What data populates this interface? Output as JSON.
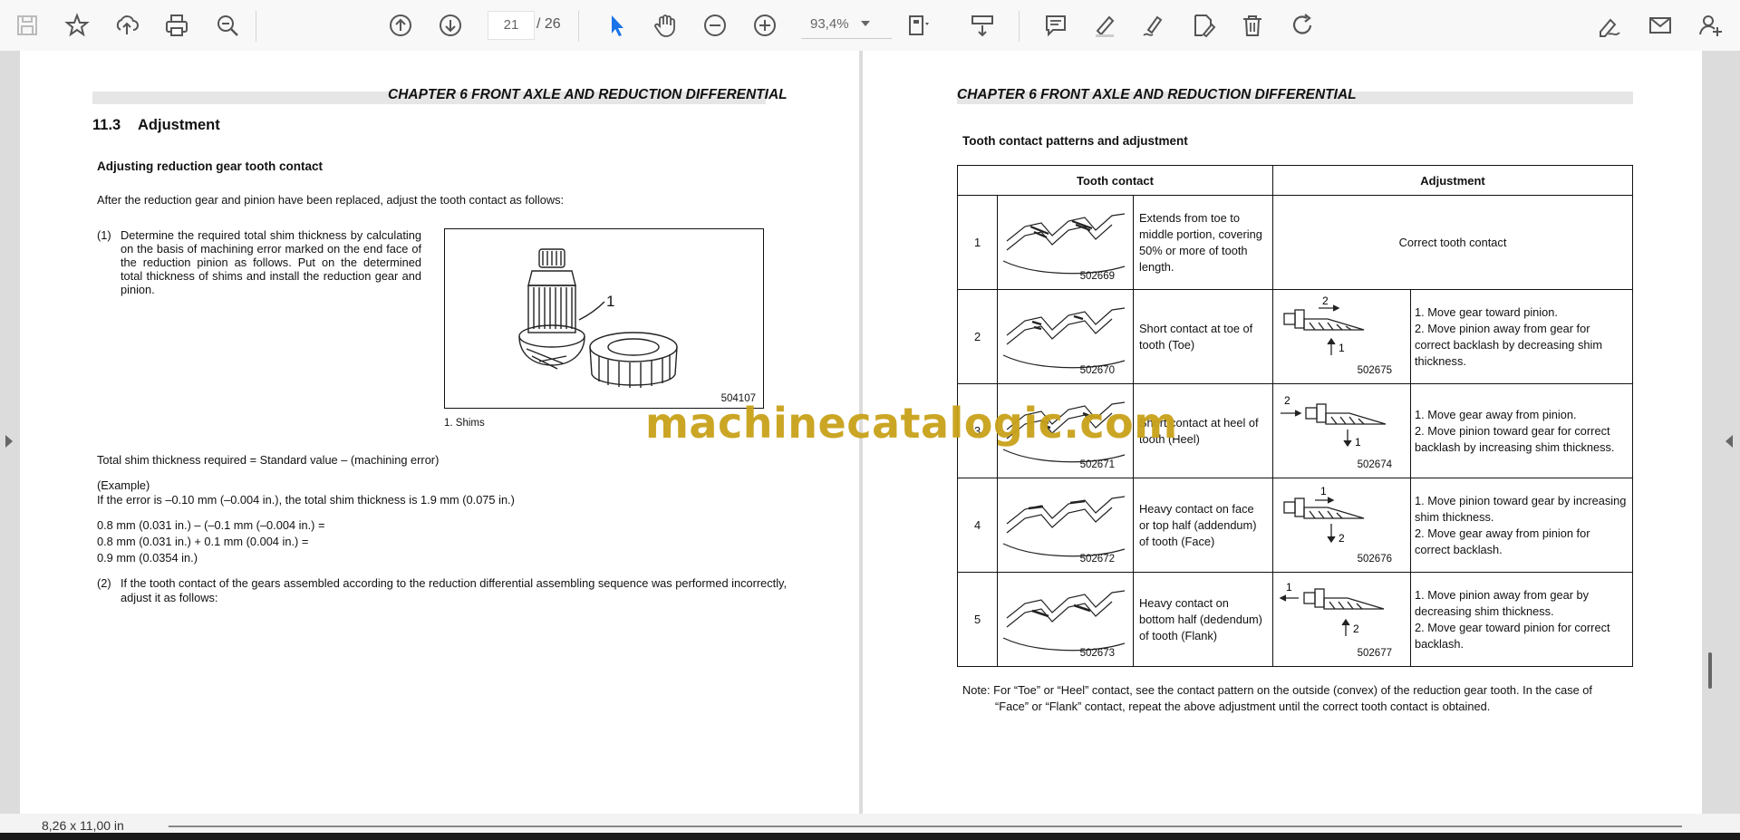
{
  "toolbar": {
    "page_current": "21",
    "page_total": "/ 26",
    "zoom": "93,4%"
  },
  "status": {
    "page_size": "8,26 x 11,00 in"
  },
  "watermark": "machinecatalogic.com",
  "left_page": {
    "chapter": "CHAPTER 6 FRONT AXLE AND REDUCTION DIFFERENTIAL",
    "section_num": "11.3",
    "section_title": "Adjustment",
    "subheading": "Adjusting reduction gear tooth contact",
    "intro": "After the reduction gear and pinion have been replaced, adjust the tooth contact as follows:",
    "step1_num": "(1)",
    "step1_text": "Determine the required total shim thickness by calculating on the basis of machining error marked on the end face of the reduction pinion as follows. Put on the determined total thickness of shims and install the reduction gear and pinion.",
    "figure_callout": "1",
    "figure_code": "504107",
    "figure_caption": "1.  Shims",
    "formula": "Total shim thickness required = Standard value – (machining error)",
    "example_label": "(Example)",
    "example_line": "If the error is –0.10 mm (–0.004 in.), the total shim thickness is 1.9 mm (0.075 in.)",
    "calc_1": "0.8 mm (0.031 in.) – (–0.1 mm (–0.004 in.) =",
    "calc_2": "0.8 mm (0.031 in.) + 0.1 mm (0.004 in.) =",
    "calc_3": "0.9 mm (0.0354 in.)",
    "step2_num": "(2)",
    "step2_text": "If the tooth contact of the gears assembled according to the reduction differential assembling sequence was performed incorrectly, adjust it as follows:"
  },
  "right_page": {
    "chapter": "CHAPTER 6 FRONT AXLE AND REDUCTION DIFFERENTIAL",
    "heading": "Tooth contact patterns and adjustment",
    "col_contact": "Tooth contact",
    "col_adjust": "Adjustment",
    "rows": [
      {
        "num": "1",
        "gear_code": "502669",
        "desc": "Extends from toe to middle portion, covering 50% or more of tooth length.",
        "adj_code": "",
        "adj": "Correct tooth contact"
      },
      {
        "num": "2",
        "gear_code": "502670",
        "desc": "Short contact at toe of tooth (Toe)",
        "adj_code": "502675",
        "adj": "1. Move gear toward pinion.\n2. Move pinion away from gear for correct backlash by decreasing shim thickness."
      },
      {
        "num": "3",
        "gear_code": "502671",
        "desc": "Short contact at heel of tooth (Heel)",
        "adj_code": "502674",
        "adj": "1. Move gear away from pinion.\n2. Move pinion toward gear for correct backlash by increasing shim thickness."
      },
      {
        "num": "4",
        "gear_code": "502672",
        "desc": "Heavy contact on face or top half (addendum) of tooth (Face)",
        "adj_code": "502676",
        "adj": "1. Move pinion toward gear by increasing shim thickness.\n2. Move gear away from pinion for correct backlash."
      },
      {
        "num": "5",
        "gear_code": "502673",
        "desc": "Heavy contact on bottom half (dedendum) of tooth (Flank)",
        "adj_code": "502677",
        "adj": "1. Move pinion away from gear by decreasing shim thickness.\n2. Move gear toward pinion for correct backlash."
      }
    ],
    "note_1": "Note: For “Toe” or “Heel” contact, see the contact pattern on the outside (convex) of the reduction gear tooth. In the case of",
    "note_2": "“Face” or “Flank” contact, repeat the above adjustment until the correct tooth contact is obtained."
  },
  "icons": [
    "save-icon",
    "bookmark-star-icon",
    "upload-icon",
    "print-icon",
    "zoom-search-icon",
    "prev-page-icon",
    "next-page-icon",
    "select-cursor-icon",
    "hand-pan-icon",
    "zoom-out-icon",
    "zoom-in-icon",
    "page-fit-icon",
    "scroll-mode-icon",
    "comment-icon",
    "highlight-pen-icon",
    "draw-icon",
    "edit-text-icon",
    "delete-icon",
    "redo-icon",
    "sign-icon",
    "email-icon",
    "add-user-icon"
  ]
}
